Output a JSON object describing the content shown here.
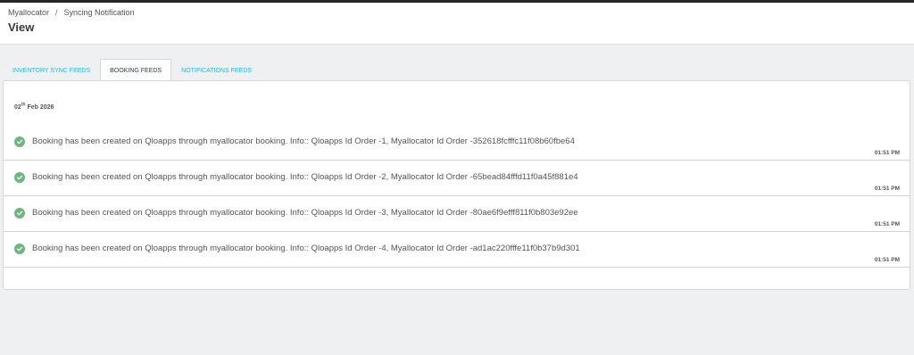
{
  "breadcrumb": {
    "items": [
      "Myallocator",
      "Syncing Notification"
    ],
    "separator": "/"
  },
  "page": {
    "title": "View"
  },
  "tabs": [
    {
      "label": "Inventory Sync Feeds",
      "active": false
    },
    {
      "label": "Booking Feeds",
      "active": true
    },
    {
      "label": "Notifications Feeds",
      "active": false
    }
  ],
  "feed": {
    "date": {
      "day": "02",
      "suffix": "th",
      "rest": "Feb 2026"
    },
    "status_icon": "check-circle-icon",
    "items": [
      {
        "text": "Booking has been created on Qloapps through myallocator booking. Info:: Qloapps Id Order -1, Myallocator Id Order -352618fcfffc11f08b60fbe64",
        "time": "01:51 PM"
      },
      {
        "text": "Booking has been created on Qloapps through myallocator booking. Info:: Qloapps Id Order -2, Myallocator Id Order -65bead84fffd11f0a45f881e4",
        "time": "01:51 PM"
      },
      {
        "text": "Booking has been created on Qloapps through myallocator booking. Info:: Qloapps Id Order -3, Myallocator Id Order -80ae6f9efff811f0b803e92ee",
        "time": "01:51 PM"
      },
      {
        "text": "Booking has been created on Qloapps through myallocator booking. Info:: Qloapps Id Order -4, Myallocator Id Order -ad1ac220fffe11f0b37b9d301",
        "time": "01:51 PM"
      }
    ]
  },
  "colors": {
    "accent": "#25b9d7",
    "success": "#70b580",
    "topbar": "#262626",
    "background": "#eef0f2"
  }
}
